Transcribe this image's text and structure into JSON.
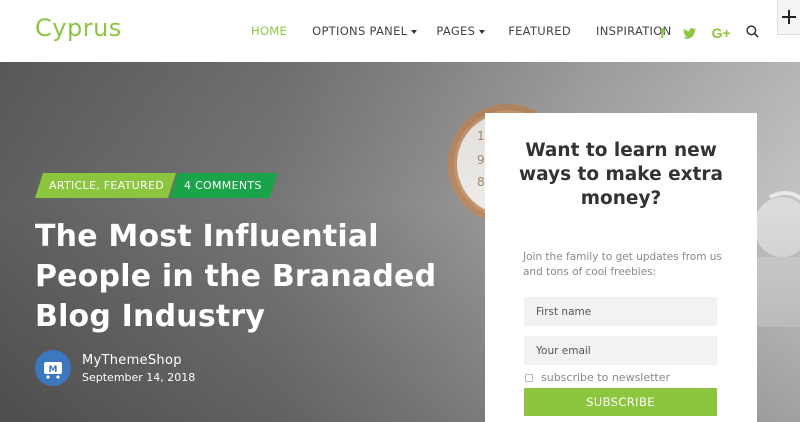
{
  "header": {
    "logo": "Cyprus",
    "nav": [
      {
        "label": "HOME",
        "active": true,
        "dropdown": false
      },
      {
        "label": "OPTIONS PANEL",
        "active": false,
        "dropdown": true
      },
      {
        "label": "PAGES",
        "active": false,
        "dropdown": true
      },
      {
        "label": "FEATURED",
        "active": false,
        "dropdown": false
      },
      {
        "label": "INSPIRATION",
        "active": false,
        "dropdown": false
      }
    ],
    "social": [
      {
        "icon": "facebook-icon",
        "glyph": "f"
      },
      {
        "icon": "twitter-icon",
        "glyph": "t"
      },
      {
        "icon": "google-plus-icon",
        "glyph": "G+"
      }
    ],
    "accent_color": "#8cc63f"
  },
  "hero": {
    "categories": "ARTICLE, FEATURED",
    "comments": "4 COMMENTS",
    "title": "The Most Influential People in the Branaded Blog Industry",
    "author_name": "MyThemeShop",
    "date": "September 14, 2018"
  },
  "newsletter": {
    "title": "Want to learn new ways to make extra money?",
    "description": "Join the family to get updates from us and tons of cool freebies:",
    "first_name_placeholder": "First name",
    "email_placeholder": "Your email",
    "checkbox_label": "subscribe to newsletter",
    "button_label": "SUBSCRIBE"
  }
}
